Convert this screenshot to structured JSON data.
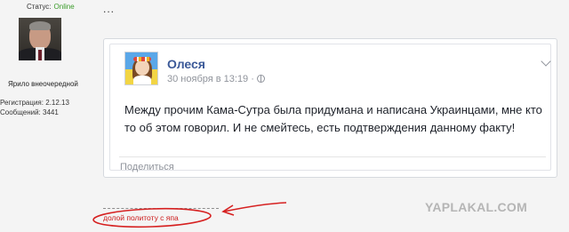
{
  "user": {
    "status_label": "Статус:",
    "status_value": "Online",
    "nickname": "Ярило внеочередной",
    "registration": "Регистрация: 2.12.13",
    "messages": "Сообщений: 3441"
  },
  "post": {
    "ellipsis": "...",
    "embed": {
      "author": "Олеся",
      "date": "30 ноября в 13:19 ·",
      "text": "Между прочим Кама-Сутра была придумана и написана Украинцами, мне кто то об этом говорил. И не смейтесь, есть подтверждения данному факту!",
      "share_label": "Поделиться"
    }
  },
  "watermark": "YAPLAKAL.COM",
  "footer": {
    "link_text": "долой политоту с япа"
  },
  "colors": {
    "online": "#3a9a2a",
    "fb_name": "#3b5998",
    "annotation_red": "#d62020"
  },
  "icons": [
    "globe-icon",
    "chevron-down-icon"
  ]
}
